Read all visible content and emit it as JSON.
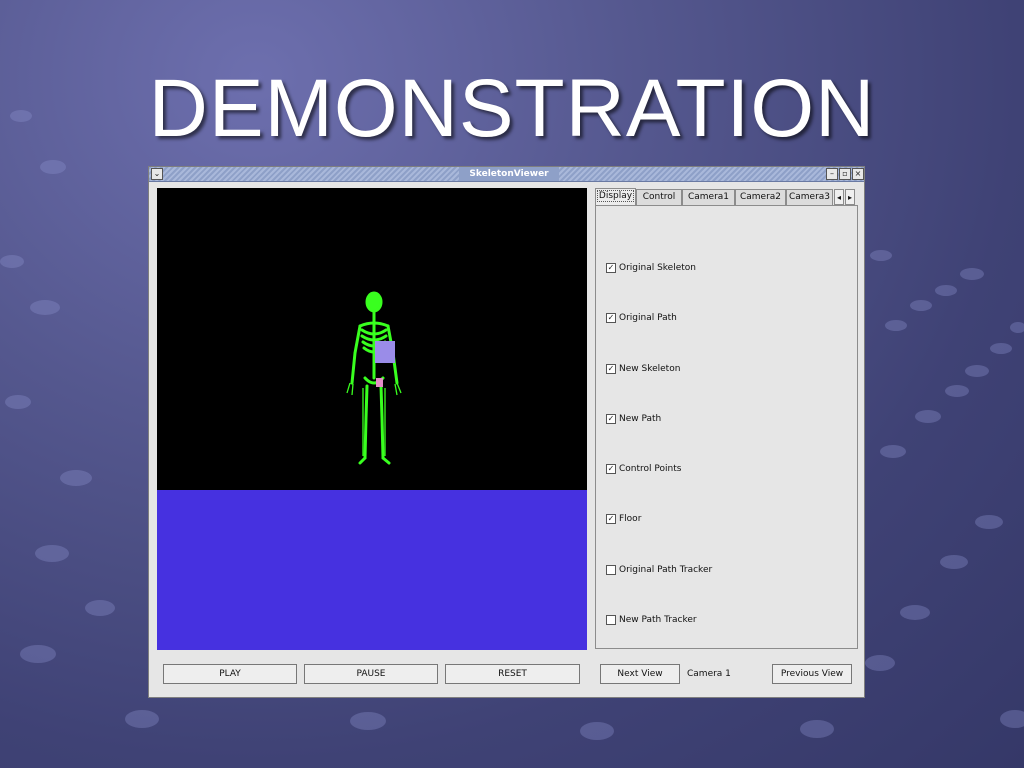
{
  "slide": {
    "title": "DEMONSTRATION"
  },
  "window": {
    "title": "SkeletonViewer",
    "menu_glyph": "⌄",
    "minimize_glyph": "–",
    "maximize_glyph": "▫",
    "close_glyph": "×"
  },
  "tabs": [
    {
      "label": "Display",
      "active": true
    },
    {
      "label": "Control",
      "active": false
    },
    {
      "label": "Camera1",
      "active": false
    },
    {
      "label": "Camera2",
      "active": false
    },
    {
      "label": "Camera3",
      "active": false
    }
  ],
  "tab_scroll": {
    "left": "◂",
    "right": "▸"
  },
  "display_options": [
    {
      "label": "Original Skeleton",
      "checked": true
    },
    {
      "label": "Original Path",
      "checked": true
    },
    {
      "label": "New Skeleton",
      "checked": true
    },
    {
      "label": "New Path",
      "checked": true
    },
    {
      "label": "Control Points",
      "checked": true
    },
    {
      "label": "Floor",
      "checked": true
    },
    {
      "label": "Original Path Tracker",
      "checked": false
    },
    {
      "label": "New Path Tracker",
      "checked": false
    }
  ],
  "checkmark": "✓",
  "controls": {
    "play": "PLAY",
    "pause": "PAUSE",
    "reset": "RESET",
    "next_view": "Next View",
    "camera_label": "Camera 1",
    "previous_view": "Previous View"
  },
  "colors": {
    "skeleton": "#39ff1f",
    "floor": "#4631e0",
    "control_point": "#9a8ce8",
    "path_marker": "#e58cc7"
  }
}
